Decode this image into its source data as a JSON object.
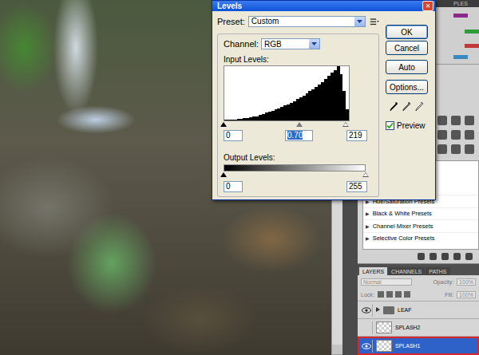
{
  "dialog": {
    "title": "Levels",
    "close": "✕",
    "preset_label": "Preset:",
    "preset": "Custom",
    "channel_label": "Channel:",
    "channel": "RGB",
    "input_label": "Input Levels:",
    "histogram": [
      1,
      1,
      2,
      2,
      3,
      3,
      4,
      5,
      6,
      7,
      8,
      10,
      12,
      14,
      16,
      18,
      20,
      22,
      25,
      28,
      30,
      33,
      36,
      40,
      43,
      46,
      50,
      54,
      58,
      62,
      66,
      70,
      76,
      82,
      88,
      92,
      100,
      86,
      55,
      20
    ],
    "input_handles": [
      {
        "kind": "black",
        "level": 0
      },
      {
        "kind": "gray",
        "level": 0.6
      },
      {
        "kind": "white",
        "level": 0.97
      }
    ],
    "input_fields": [
      {
        "value": "0",
        "selected": false
      },
      {
        "value": "0.70",
        "selected": true
      },
      {
        "value": "219",
        "selected": false
      }
    ],
    "output_label": "Output Levels:",
    "output_handles": [
      {
        "kind": "black",
        "level": 0
      },
      {
        "kind": "white",
        "level": 1
      }
    ],
    "output_fields": [
      {
        "value": "0"
      },
      {
        "value": "255"
      }
    ],
    "buttons": [
      {
        "label": "OK",
        "default": true
      },
      {
        "label": "Cancel",
        "default": false
      },
      {
        "label": "Auto",
        "default": false
      },
      {
        "label": "Options...",
        "default": false
      }
    ],
    "preview": {
      "label": "Preview",
      "checked": true
    }
  },
  "dock": {
    "styles_tab": "PLES",
    "presets": [
      {
        "arrow": "▶",
        "label": "Hue/Saturation Presets",
        "expanded": false
      },
      {
        "arrow": "▶",
        "label": "Black & White Presets",
        "expanded": false
      },
      {
        "arrow": "▶",
        "label": "Channel Mixer Presets",
        "expanded": false
      },
      {
        "arrow": "▶",
        "label": "Selective Color Presets",
        "expanded": false
      }
    ]
  },
  "layers_panel": {
    "tabs": [
      {
        "label": "LAYERS",
        "selected": true
      },
      {
        "label": "CHANNELS",
        "selected": false
      },
      {
        "label": "PATHS",
        "selected": false
      }
    ],
    "blend_mode": "Normal",
    "opacity_label": "Opacity:",
    "opacity": "100%",
    "lock_label": "Lock:",
    "fill_label": "Fill:",
    "fill": "100%",
    "layers": [
      {
        "name": "LEAF",
        "kind": "group",
        "visible": true,
        "selected": false
      },
      {
        "name": "SPLASH2",
        "kind": "layer",
        "visible": false,
        "selected": false
      },
      {
        "name": "SPLASH1",
        "kind": "layer",
        "visible": true,
        "selected": true
      }
    ]
  }
}
